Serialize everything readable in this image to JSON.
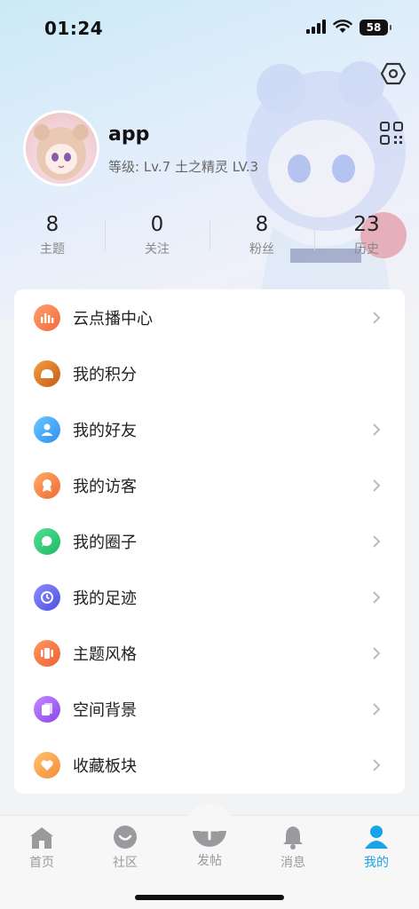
{
  "status_bar": {
    "time": "01:24",
    "battery": "58"
  },
  "profile": {
    "username": "app",
    "level_text": "等级: Lv.7 土之精灵 LV.3"
  },
  "stats": [
    {
      "value": "8",
      "label": "主题"
    },
    {
      "value": "0",
      "label": "关注"
    },
    {
      "value": "8",
      "label": "粉丝"
    },
    {
      "value": "23",
      "label": "历史"
    }
  ],
  "menu": [
    {
      "label": "云点播中心",
      "icon": "bar-chart-icon",
      "color": "#f7804a"
    },
    {
      "label": "我的积分",
      "icon": "bun-icon",
      "color": "#e0782a"
    },
    {
      "label": "我的好友",
      "icon": "person-icon",
      "color": "#3fa9f5"
    },
    {
      "label": "我的访客",
      "icon": "badge-icon",
      "color": "#f58a4a"
    },
    {
      "label": "我的圈子",
      "icon": "chat-icon",
      "color": "#2fc77a"
    },
    {
      "label": "我的足迹",
      "icon": "clock-icon",
      "color": "#6a6ef0"
    },
    {
      "label": "主题风格",
      "icon": "palette-icon",
      "color": "#f77a45"
    },
    {
      "label": "空间背景",
      "icon": "cards-icon",
      "color": "#9b5cf0"
    },
    {
      "label": "收藏板块",
      "icon": "heart-icon",
      "color": "#f7a53a"
    }
  ],
  "tabs": [
    {
      "label": "首页",
      "icon": "home-icon"
    },
    {
      "label": "社区",
      "icon": "community-icon"
    },
    {
      "label": "发帖",
      "icon": "plus-icon"
    },
    {
      "label": "消息",
      "icon": "bell-icon"
    },
    {
      "label": "我的",
      "icon": "profile-icon",
      "active": true
    }
  ],
  "colors": {
    "accent": "#1aa3e8",
    "tab_inactive": "#9a9a9e"
  }
}
